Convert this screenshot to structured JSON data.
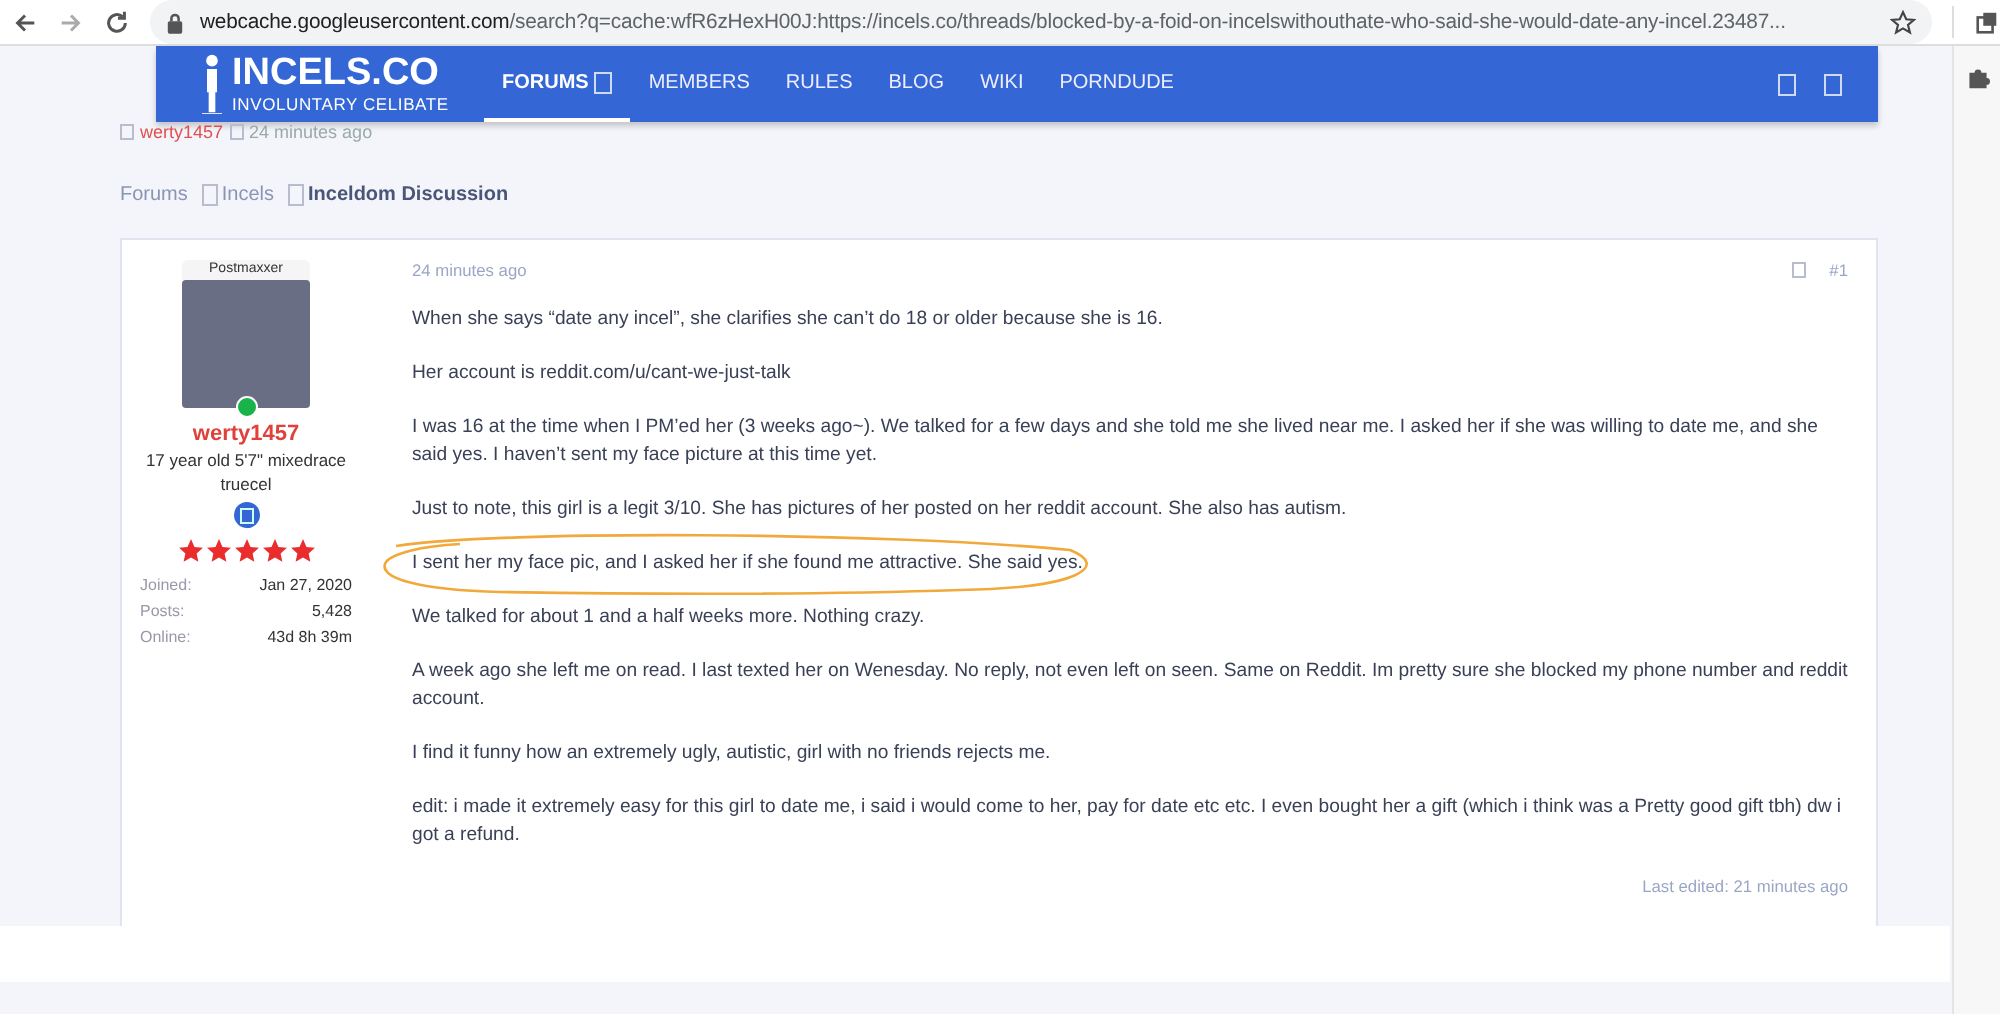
{
  "browser": {
    "url_host": "webcache.googleusercontent.com",
    "url_rest": "/search?q=cache:wfR6zHexH00J:https://incels.co/threads/blocked-by-a-foid-on-incelswithouthate-who-said-she-would-date-any-incel.23487..."
  },
  "nav": {
    "logo_title": "INCELS.CO",
    "logo_subtitle": "INVOLUNTARY CELIBATE",
    "items": [
      {
        "label": "FORUMS",
        "selected": true,
        "has_icon": true
      },
      {
        "label": "MEMBERS",
        "selected": false,
        "has_icon": false
      },
      {
        "label": "RULES",
        "selected": false,
        "has_icon": false
      },
      {
        "label": "BLOG",
        "selected": false,
        "has_icon": false
      },
      {
        "label": "WIKI",
        "selected": false,
        "has_icon": false
      },
      {
        "label": "PORNDUDE",
        "selected": false,
        "has_icon": false
      }
    ]
  },
  "thread_meta": {
    "author": "werty1457",
    "time": "24 minutes ago"
  },
  "breadcrumbs": [
    {
      "label": "Forums",
      "selected": false
    },
    {
      "label": "Incels",
      "selected": false
    },
    {
      "label": "Inceldom Discussion",
      "selected": true
    }
  ],
  "post": {
    "user": {
      "title": "Postmaxxer",
      "online": true,
      "name": "werty1457",
      "bio": "17 year old 5'7\" mixedrace truecel",
      "stars": 5,
      "stats": [
        {
          "label": "Joined:",
          "value": "Jan 27, 2020"
        },
        {
          "label": "Posts:",
          "value": "5,428"
        },
        {
          "label": "Online:",
          "value": "43d 8h 39m"
        }
      ]
    },
    "time": "24 minutes ago",
    "number": "#1",
    "paragraphs": [
      {
        "text": "When she says “date any incel”, she clarifies she can’t do 18 or older because she is 16.",
        "highlighted": false
      },
      {
        "text": "Her account is reddit.com/u/cant-we-just-talk",
        "highlighted": false
      },
      {
        "text": "I was 16 at the time when I PM’ed her (3 weeks ago~). We talked for a few days and she told me she lived near me. I asked her if she was willing to date me, and she said yes. I haven’t sent my face picture at this time yet.",
        "highlighted": false
      },
      {
        "text": "Just to note, this girl is a legit 3/10. She has pictures of her posted on her reddit account. She also has autism.",
        "highlighted": false
      },
      {
        "text": "I sent her my face pic, and I asked her if she found me attractive. She said yes.",
        "highlighted": true
      },
      {
        "text": "We talked for about 1 and a half weeks more. Nothing crazy.",
        "highlighted": false
      },
      {
        "text": "A week ago she left me on read. I last texted her on Wenesday. No reply, not even left on seen. Same on Reddit. Im pretty sure she blocked my phone number and reddit account.",
        "highlighted": false
      },
      {
        "text": "I find it funny how an extremely ugly, autistic, girl with no friends rejects me.",
        "highlighted": false
      },
      {
        "text": "edit: i made it extremely easy for this girl to date me, i said i would come to her, pay for date etc etc. I even bought her a gift (which i think was a Pretty good gift tbh) dw i got a refund.",
        "highlighted": false
      }
    ],
    "last_edited": "Last edited: 21 minutes ago"
  }
}
